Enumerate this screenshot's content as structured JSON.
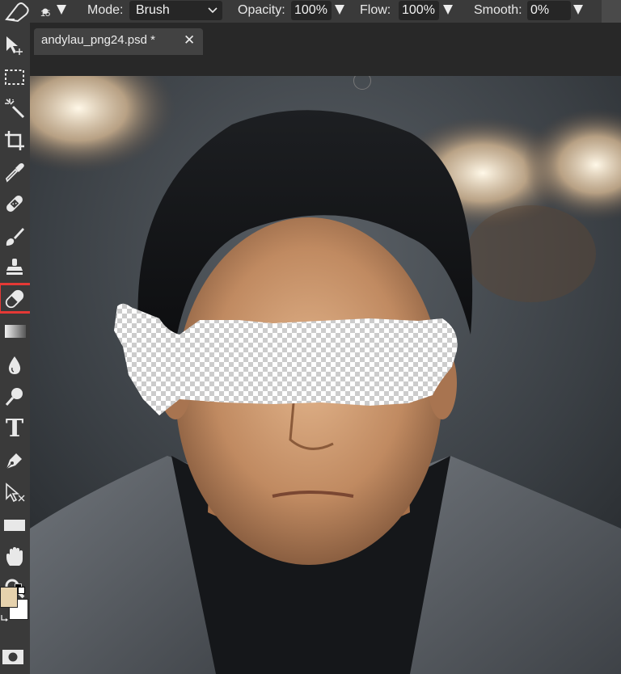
{
  "options_bar": {
    "brush_size": "15",
    "mode_label": "Mode:",
    "mode_value": "Brush",
    "opacity_label": "Opacity:",
    "opacity_value": "100%",
    "flow_label": "Flow:",
    "flow_value": "100%",
    "smooth_label": "Smooth:",
    "smooth_value": "0%"
  },
  "document": {
    "tab_title": "andylau_png24.psd *",
    "close_glyph": "✕"
  },
  "toolbar": {
    "tools": [
      "move-tool",
      "marquee-tool",
      "magic-wand-tool",
      "crop-tool",
      "eyedropper-tool",
      "healing-brush-tool",
      "brush-tool",
      "clone-stamp-tool",
      "eraser-tool",
      "gradient-tool",
      "blur-tool",
      "dodge-tool",
      "type-tool",
      "pen-tool",
      "path-selection-tool",
      "rectangle-tool",
      "hand-tool",
      "zoom-tool"
    ],
    "active_tool": "eraser-tool",
    "type_glyph": "T",
    "highlight_color": "#e53935",
    "foreground_color": "#e6d2ad",
    "background_color": "#ffffff"
  },
  "colors": {
    "ui_panel": "#3a3a3a",
    "canvas_bg": "#282828"
  }
}
